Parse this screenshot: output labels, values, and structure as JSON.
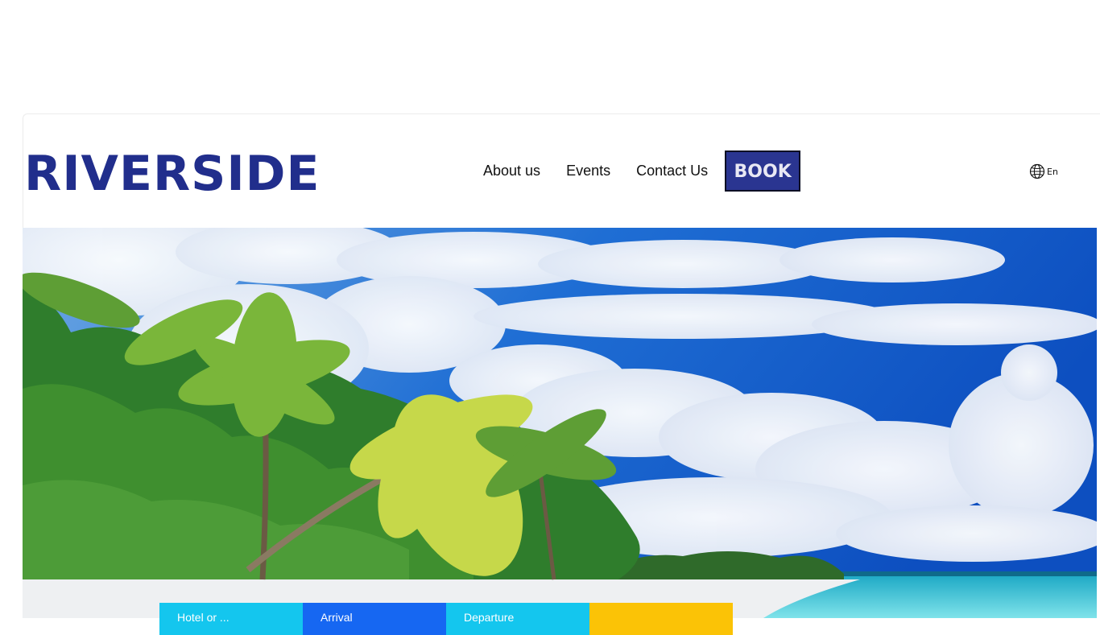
{
  "brand": {
    "logo_text": "RIVERSIDE",
    "color": "#212e8c"
  },
  "nav": {
    "items": [
      {
        "label": "About us"
      },
      {
        "label": "Events"
      },
      {
        "label": "Contact Us"
      }
    ],
    "book_label": "BOOK",
    "book_color": "#2a3591"
  },
  "language": {
    "icon": "globe-icon",
    "label": "En"
  },
  "hero": {
    "image": "tropical beach with palm trees under blue sky"
  },
  "booking": {
    "hotel_label": "Hotel or ...",
    "arrival_label": "Arrival",
    "departure_label": "Departure",
    "submit_label": "",
    "colors": {
      "hotel": "#14c6ee",
      "arrival": "#1667f2",
      "departure": "#14c6ee",
      "submit": "#fbc306"
    }
  }
}
